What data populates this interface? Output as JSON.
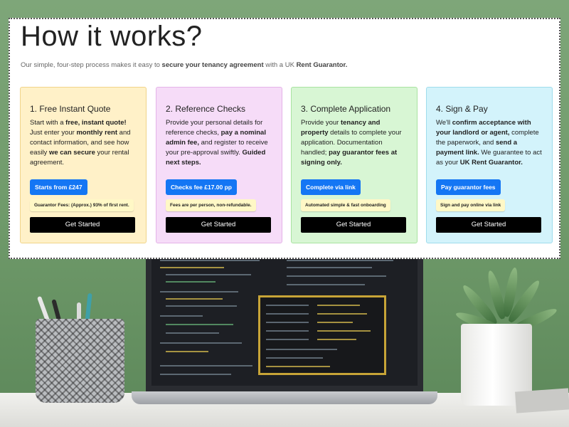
{
  "page": {
    "title": "How it works?",
    "intro_pre": "Our simple, four-step process makes it easy to ",
    "intro_bold1": "secure your tenancy agreement",
    "intro_mid": " with a UK ",
    "intro_bold2": "Rent Guarantor."
  },
  "colors": {
    "card1_bg": "#fff1c8",
    "card1_border": "#f0d48a",
    "card2_bg": "#f6dcf8",
    "card2_border": "#e4b3e8",
    "card3_bg": "#d8f6d4",
    "card3_border": "#a9e3a1",
    "card4_bg": "#d3f3fb",
    "card4_border": "#9fdcec",
    "primary_button": "#1476f4",
    "badge_bg": "#fff8c6",
    "cta_bg": "#000000"
  },
  "steps": [
    {
      "title": "1. Free Instant Quote",
      "body": [
        {
          "t": "Start with a ",
          "b": false
        },
        {
          "t": "free, instant quote!",
          "b": true
        },
        {
          "t": " Just enter your ",
          "b": false
        },
        {
          "t": "monthly rent",
          "b": true
        },
        {
          "t": " and contact information, and see how easily ",
          "b": false
        },
        {
          "t": "we can secure",
          "b": true
        },
        {
          "t": " your rental agreement.",
          "b": false
        }
      ],
      "button": "Starts from £247",
      "badge": "Guarantor Fees: (Approx.) 93% of first rent.",
      "cta": "Get Started"
    },
    {
      "title": "2. Reference Checks",
      "body": [
        {
          "t": "Provide your personal details for reference checks, ",
          "b": false
        },
        {
          "t": "pay a nominal admin fee,",
          "b": true
        },
        {
          "t": " and register to receive your pre-approval swiftly. ",
          "b": false
        },
        {
          "t": "Guided next steps.",
          "b": true
        }
      ],
      "button": "Checks fee £17.00 pp",
      "badge": "Fees are per person, non-refundable.",
      "cta": "Get Started"
    },
    {
      "title": "3. Complete Application",
      "body": [
        {
          "t": "Provide your ",
          "b": false
        },
        {
          "t": "tenancy and property",
          "b": true
        },
        {
          "t": " details to complete your application. Documentation handled; ",
          "b": false
        },
        {
          "t": "pay guarantor fees at signing only.",
          "b": true
        }
      ],
      "button": "Complete via link",
      "badge": "Automated simple & fast onboarding",
      "cta": "Get Started"
    },
    {
      "title": "4. Sign & Pay",
      "body": [
        {
          "t": "We'll ",
          "b": false
        },
        {
          "t": "confirm acceptance with your landlord or agent,",
          "b": true
        },
        {
          "t": " complete the paperwork, and ",
          "b": false
        },
        {
          "t": "send a payment link.",
          "b": true
        },
        {
          "t": " We guarantee to act as your ",
          "b": false
        },
        {
          "t": "UK Rent Guarantor.",
          "b": true
        }
      ],
      "button": "Pay guarantor fees",
      "badge": "Sign and pay online via link",
      "cta": "Get Started"
    }
  ]
}
